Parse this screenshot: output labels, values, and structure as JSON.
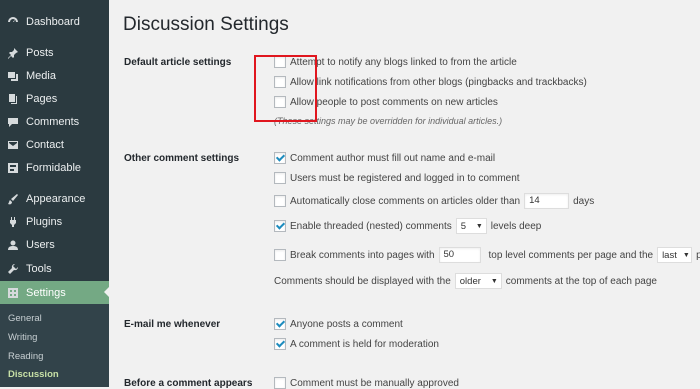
{
  "sidebar": {
    "items": [
      {
        "label": "Dashboard",
        "icon": "dashboard-icon"
      },
      {
        "label": "Posts",
        "icon": "pin-icon"
      },
      {
        "label": "Media",
        "icon": "media-icon"
      },
      {
        "label": "Pages",
        "icon": "pages-icon"
      },
      {
        "label": "Comments",
        "icon": "comment-icon"
      },
      {
        "label": "Contact",
        "icon": "mail-icon"
      },
      {
        "label": "Formidable",
        "icon": "grid-icon"
      },
      {
        "label": "Appearance",
        "icon": "brush-icon"
      },
      {
        "label": "Plugins",
        "icon": "plug-icon"
      },
      {
        "label": "Users",
        "icon": "user-icon"
      },
      {
        "label": "Tools",
        "icon": "wrench-icon"
      },
      {
        "label": "Settings",
        "icon": "settings-icon"
      }
    ],
    "submenu": [
      "General",
      "Writing",
      "Reading",
      "Discussion"
    ],
    "active_color": "#74a984",
    "background": "#2b3a40"
  },
  "page": {
    "title": "Discussion Settings"
  },
  "default_article": {
    "label": "Default article settings",
    "opt1": "Attempt to notify any blogs linked to from the article",
    "opt2": "Allow link notifications from other blogs (pingbacks and trackbacks)",
    "opt3": "Allow people to post comments on new articles",
    "note": "(These settings may be overridden for individual articles.)"
  },
  "other_comment": {
    "label": "Other comment settings",
    "opt1": "Comment author must fill out name and e-mail",
    "opt2": "Users must be registered and logged in to comment",
    "opt3_pre": "Automatically close comments on articles older than",
    "opt3_value": "14",
    "opt3_post": "days",
    "opt4_pre": "Enable threaded (nested) comments",
    "opt4_value": "5",
    "opt4_post": "levels deep",
    "opt5_pre": "Break comments into pages with",
    "opt5_value": "50",
    "opt5_mid": "top level comments per page and the",
    "opt5_select": "last",
    "opt5_post": "pa",
    "opt6_pre": "Comments should be displayed with the",
    "opt6_select": "older",
    "opt6_post": "comments at the top of each page"
  },
  "email": {
    "label": "E-mail me whenever",
    "opt1": "Anyone posts a comment",
    "opt2": "A comment is held for moderation"
  },
  "before_comment": {
    "label": "Before a comment appears",
    "opt1": "Comment must be manually approved"
  },
  "highlight_color": "#e0161e"
}
